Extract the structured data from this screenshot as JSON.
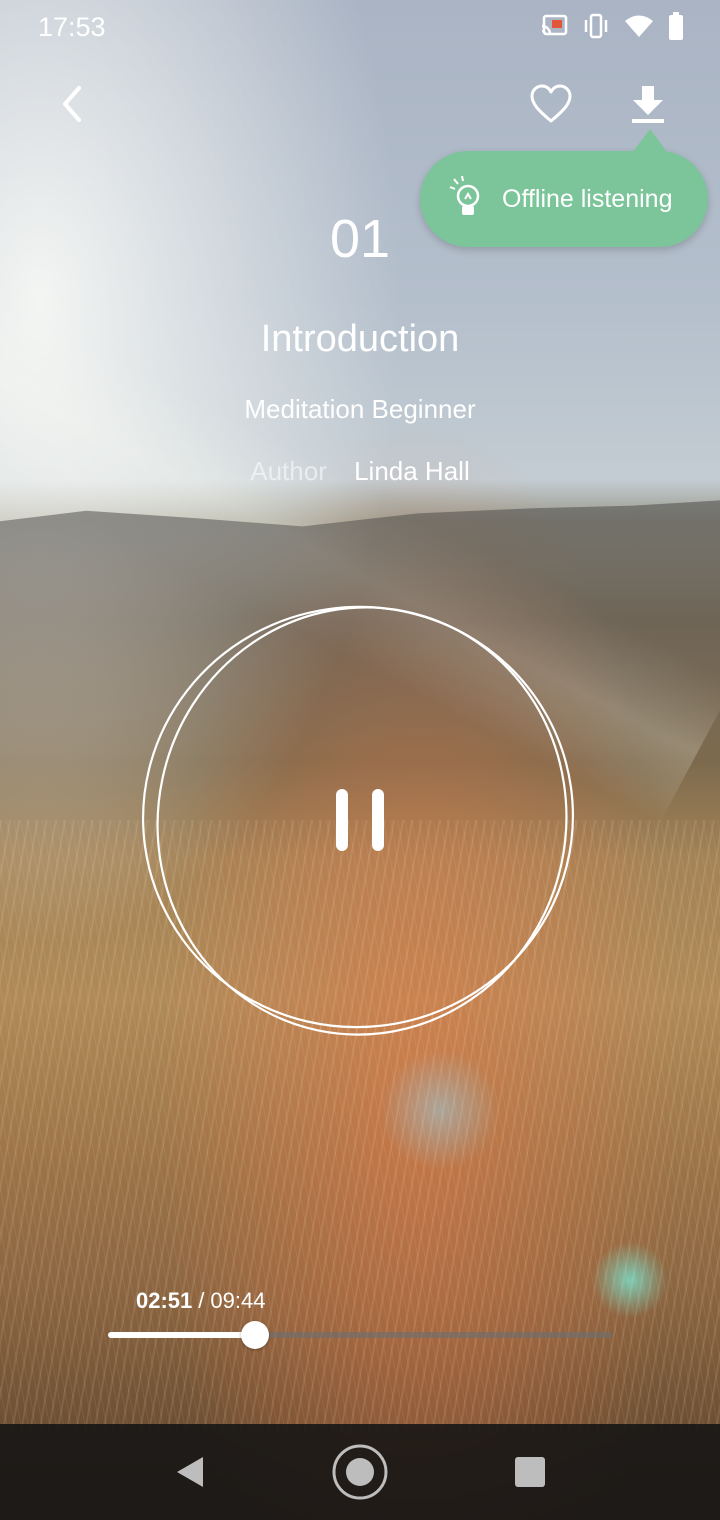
{
  "status_bar": {
    "time": "17:53",
    "icons": [
      "cast-icon",
      "vibrate-icon",
      "wifi-icon",
      "battery-icon"
    ]
  },
  "toolbar": {
    "back_icon": "chevron-left-icon",
    "favorite_icon": "heart-outline-icon",
    "download_icon": "download-icon"
  },
  "tooltip": {
    "text": "Offline listening",
    "icon": "lightbulb-icon",
    "color": "#7cc49a"
  },
  "track": {
    "number": "01",
    "title": "Introduction",
    "course": "Meditation Beginner",
    "author_label": "Author",
    "author_name": "Linda Hall"
  },
  "player": {
    "state_icon": "pause-icon",
    "current_time": "02:51",
    "separator": "/",
    "total_time": "09:44",
    "progress": 0.292
  },
  "nav_bar": {
    "icons": [
      "nav-back-icon",
      "nav-home-icon",
      "nav-recent-icon"
    ]
  }
}
